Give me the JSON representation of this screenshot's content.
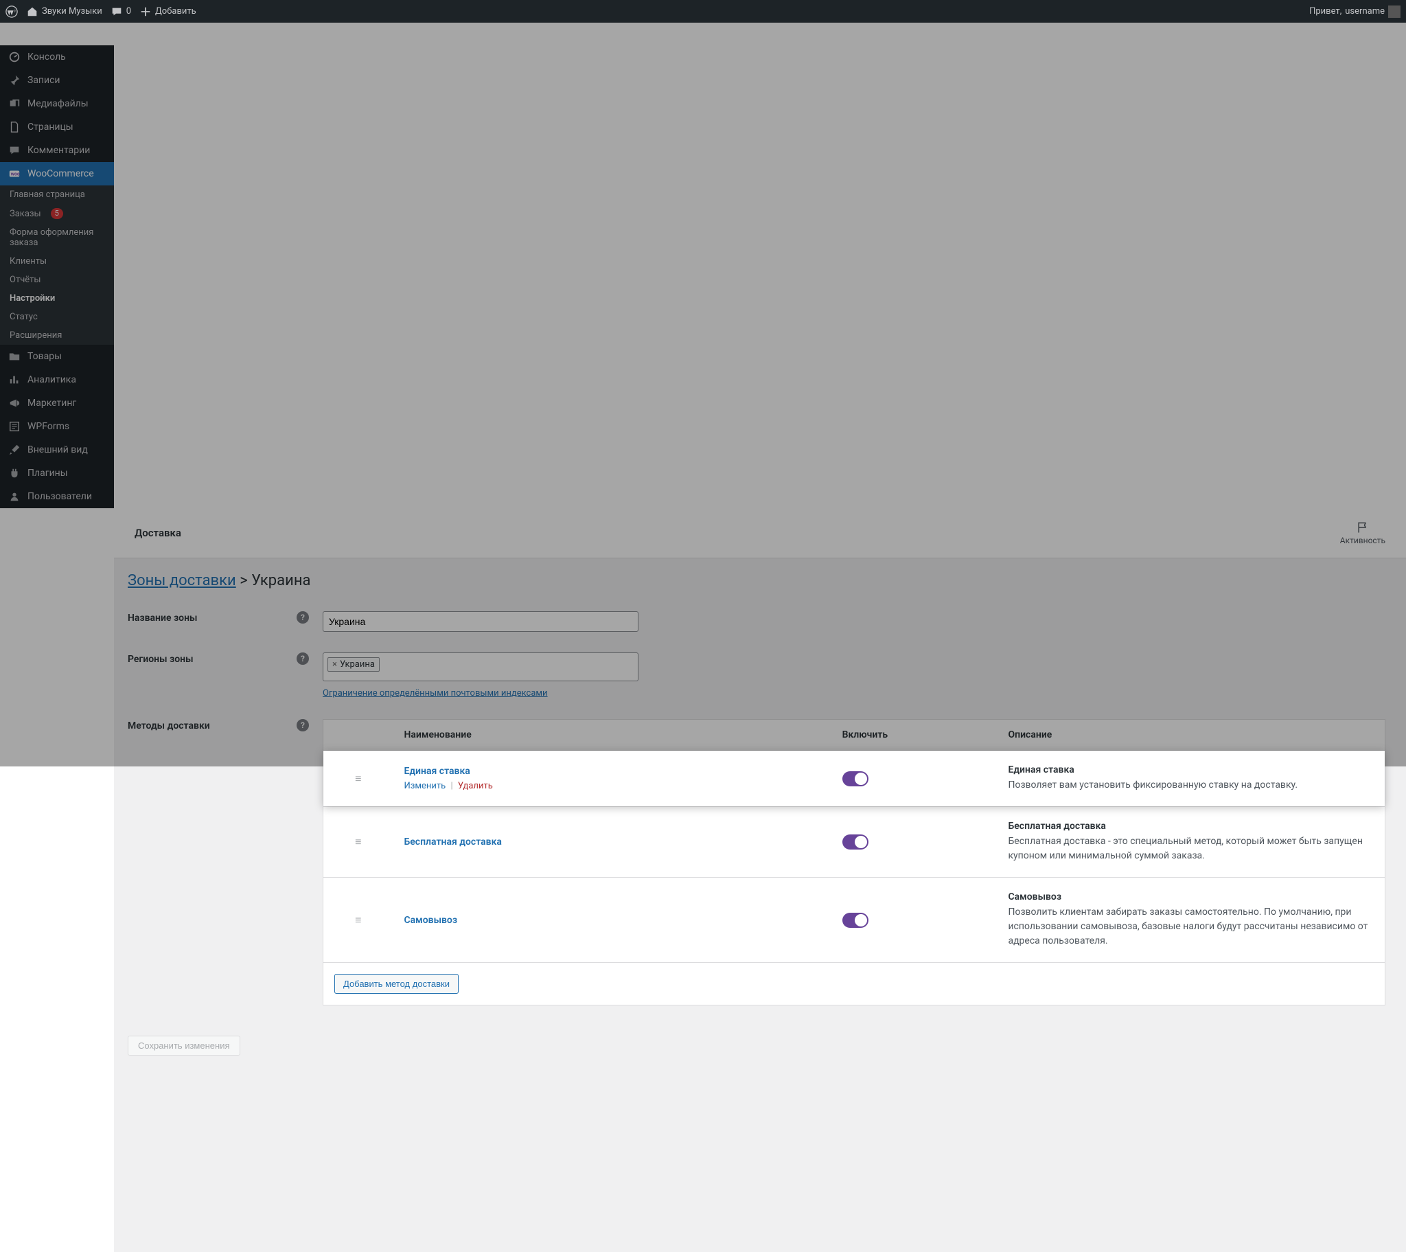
{
  "adminbar": {
    "site_name": "Звуки Музыки",
    "comments_count": "0",
    "add_new": "Добавить",
    "howdy_prefix": "Привет,",
    "username": "username"
  },
  "sidebar": {
    "items": [
      {
        "label": "Консоль",
        "icon": "dashboard"
      },
      {
        "label": "Записи",
        "icon": "pin"
      },
      {
        "label": "Медиафайлы",
        "icon": "media"
      },
      {
        "label": "Страницы",
        "icon": "page"
      },
      {
        "label": "Комментарии",
        "icon": "comment"
      },
      {
        "label": "WooCommerce",
        "icon": "woo",
        "current": true
      },
      {
        "label": "Товары",
        "icon": "folder"
      },
      {
        "label": "Аналитика",
        "icon": "chart"
      },
      {
        "label": "Маркетинг",
        "icon": "megaphone"
      },
      {
        "label": "WPForms",
        "icon": "form"
      },
      {
        "label": "Внешний вид",
        "icon": "brush"
      },
      {
        "label": "Плагины",
        "icon": "plugin"
      },
      {
        "label": "Пользователи",
        "icon": "user"
      }
    ],
    "woo_submenu": [
      {
        "label": "Главная страница"
      },
      {
        "label": "Заказы",
        "badge": "5"
      },
      {
        "label": "Форма оформления заказа"
      },
      {
        "label": "Клиенты"
      },
      {
        "label": "Отчёты"
      },
      {
        "label": "Настройки",
        "current": true
      },
      {
        "label": "Статус"
      },
      {
        "label": "Расширения"
      }
    ]
  },
  "header": {
    "title": "Доставка",
    "activity_label": "Активность"
  },
  "breadcrumb": {
    "root": "Зоны доставки",
    "sep": ">",
    "leaf": "Украина"
  },
  "zone_form": {
    "name_label": "Название зоны",
    "name_value": "Украина",
    "regions_label": "Регионы зоны",
    "region_tag": "Украина",
    "postcodes_link": "Ограничение определёнными почтовыми индексами",
    "methods_label": "Методы доставки"
  },
  "methods_table": {
    "cols": {
      "name": "Наименование",
      "enable": "Включить",
      "desc": "Описание"
    },
    "rows": [
      {
        "name": "Единая ставка",
        "actions": {
          "edit": "Изменить",
          "delete": "Удалить"
        },
        "desc_title": "Единая ставка",
        "desc_body": "Позволяет вам установить фиксированную ставку на доставку.",
        "enabled": true,
        "highlighted": true
      },
      {
        "name": "Бесплатная доставка",
        "desc_title": "Бесплатная доставка",
        "desc_body": "Бесплатная доставка - это специальный метод, который может быть запущен купоном или минимальной суммой заказа.",
        "enabled": true
      },
      {
        "name": "Самовывоз",
        "desc_title": "Самовывоз",
        "desc_body": "Позволить клиентам забирать заказы самостоятельно. По умолчанию, при использовании самовывоза, базовые налоги будут рассчитаны независимо от адреса пользователя.",
        "enabled": true
      }
    ],
    "add_button": "Добавить метод доставки"
  },
  "save_button": "Сохранить изменения"
}
